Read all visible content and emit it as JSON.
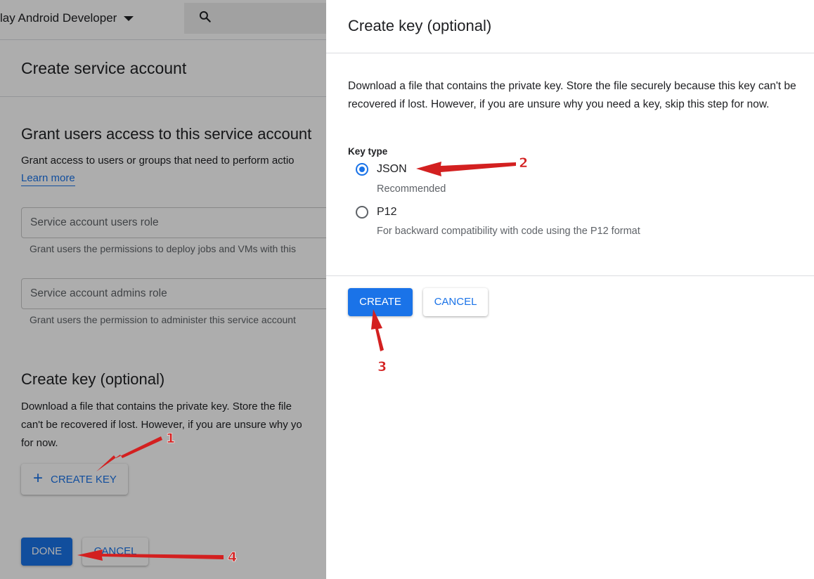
{
  "topbar": {
    "project_name": "lay Android Developer",
    "search_icon": "search-icon",
    "dropdown_icon": "caret-down-icon"
  },
  "page": {
    "title": "Create service account",
    "grant_section": {
      "heading": "Grant users access to this service account",
      "description": "Grant access to users or groups that need to perform actio",
      "learn_more": "Learn more"
    },
    "users_role": {
      "placeholder": "Service account users role",
      "hint": "Grant users the permissions to deploy jobs and VMs with this"
    },
    "admins_role": {
      "placeholder": "Service account admins role",
      "hint": "Grant users the permission to administer this service account"
    },
    "key_section": {
      "heading": "Create key (optional)",
      "lines": [
        "Download a file that contains the private key. Store the file",
        "can't be recovered if lost. However, if you are unsure why yo",
        "for now."
      ],
      "create_key_button": "CREATE KEY",
      "plus_icon": "plus-icon"
    },
    "done_button": "DONE",
    "cancel_button": "CANCEL"
  },
  "drawer": {
    "title": "Create key (optional)",
    "description": "Download a file that contains the private key. Store the file securely because this key can't be recovered if lost. However, if you are unsure why you need a key, skip this step for now.",
    "key_type_label": "Key type",
    "options": [
      {
        "label": "JSON",
        "sublabel": "Recommended",
        "selected": true
      },
      {
        "label": "P12",
        "sublabel": "For backward compatibility with code using the P12 format",
        "selected": false
      }
    ],
    "create_button": "CREATE",
    "cancel_button": "CANCEL"
  },
  "annotations": {
    "color": "#d32020",
    "markers": [
      "1",
      "2",
      "3",
      "4"
    ]
  }
}
